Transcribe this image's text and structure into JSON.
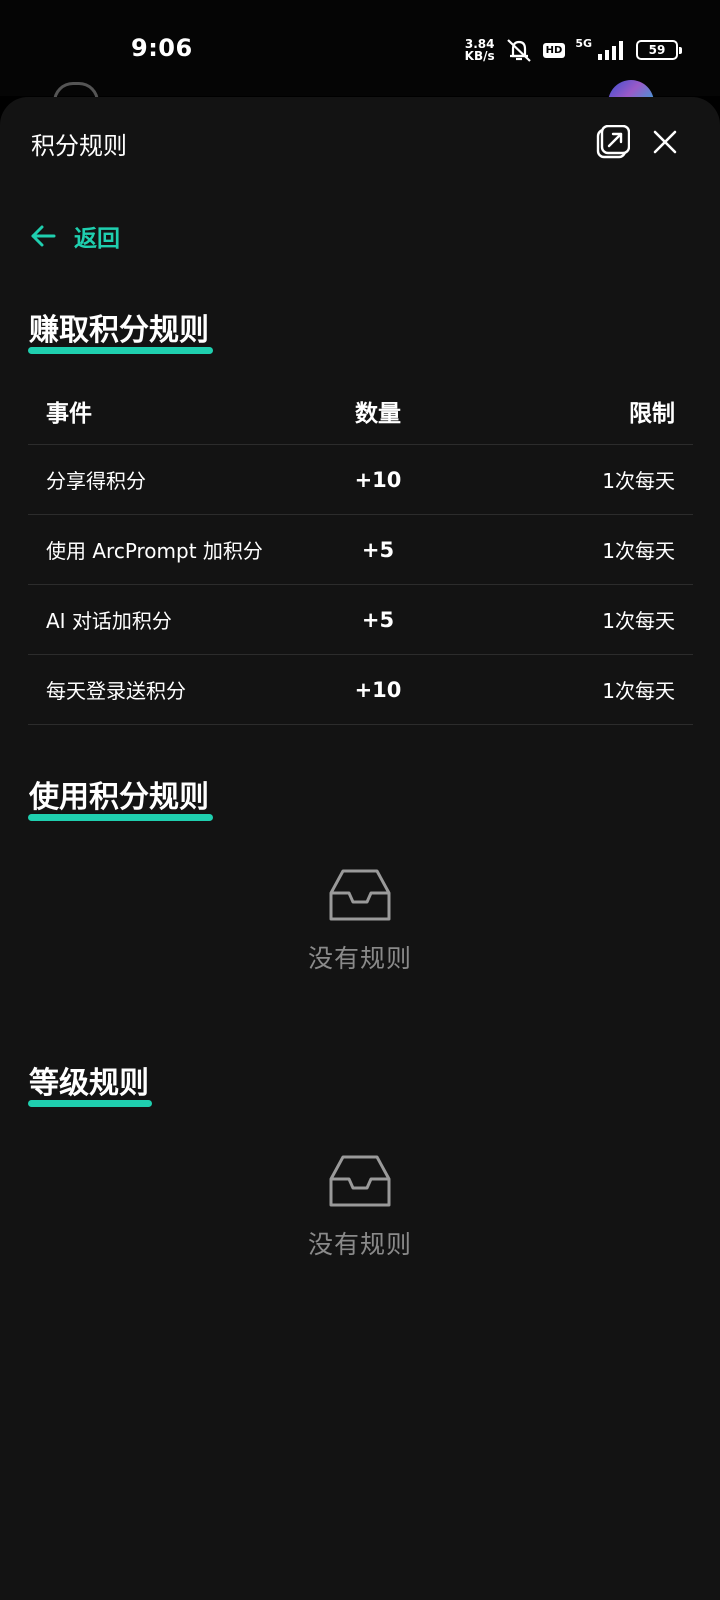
{
  "status": {
    "time": "9:06",
    "net_speed_value": "3.84",
    "net_speed_unit": "KB/s",
    "hd": "HD",
    "network": "5G",
    "battery": "59"
  },
  "sheet": {
    "title": "积分规则",
    "back_label": "返回"
  },
  "earn_section": {
    "title": "赚取积分规则",
    "columns": {
      "event": "事件",
      "qty": "数量",
      "limit": "限制"
    },
    "rows": [
      {
        "event": "分享得积分",
        "qty": "+10",
        "limit": "1次每天"
      },
      {
        "event": "使用 ArcPrompt 加积分",
        "qty": "+5",
        "limit": "1次每天"
      },
      {
        "event": "AI 对话加积分",
        "qty": "+5",
        "limit": "1次每天"
      },
      {
        "event": "每天登录送积分",
        "qty": "+10",
        "limit": "1次每天"
      }
    ]
  },
  "use_section": {
    "title": "使用积分规则",
    "empty_text": "没有规则"
  },
  "level_section": {
    "title": "等级规则",
    "empty_text": "没有规则"
  },
  "colors": {
    "accent": "#1fcfaf",
    "sheet_bg": "#131313",
    "muted": "#8a8a8a"
  },
  "icons": [
    "open-external-icon",
    "close-icon",
    "back-arrow-icon",
    "inbox-empty-icon",
    "mute-bell-icon",
    "signal-bars-icon",
    "battery-icon"
  ]
}
